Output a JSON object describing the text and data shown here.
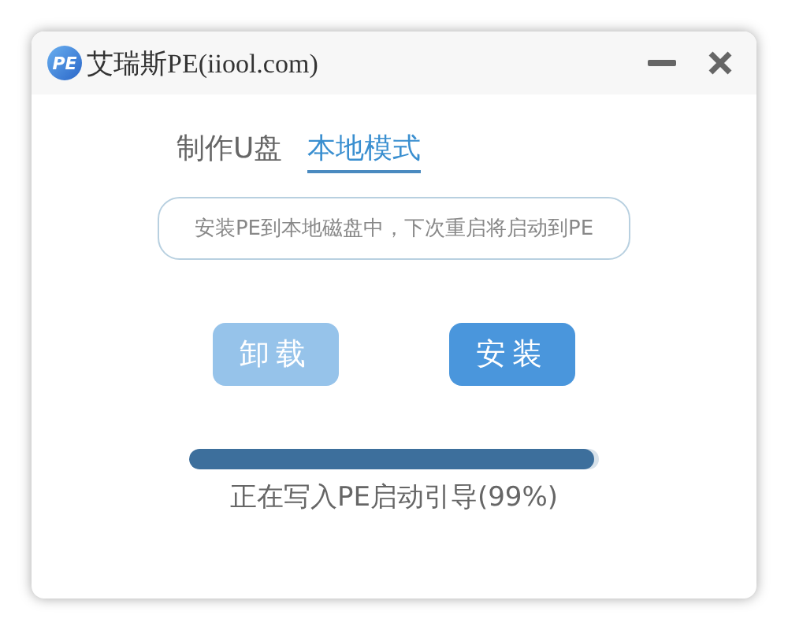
{
  "window": {
    "title": "艾瑞斯PE(iiool.com)",
    "logo": "PE"
  },
  "tabs": [
    {
      "label": "制作U盘",
      "selected": false
    },
    {
      "label": "本地模式",
      "selected": true
    }
  ],
  "info_field": {
    "value": "安装PE到本地磁盘中，下次重启将启动到PE"
  },
  "buttons": [
    {
      "label": "卸载",
      "disabled": true
    },
    {
      "label": "安装",
      "disabled": false
    }
  ],
  "progress": {
    "level": 0.99,
    "status": "正在写入PE启动引导(99%)"
  }
}
